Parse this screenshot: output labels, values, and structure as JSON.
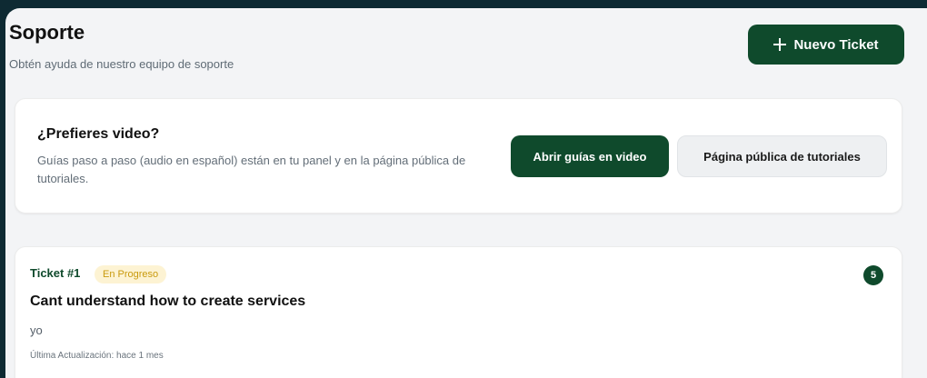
{
  "header": {
    "title": "Soporte",
    "subtitle": "Obtén ayuda de nuestro equipo de soporte",
    "new_ticket_label": "Nuevo Ticket"
  },
  "video_card": {
    "title": "¿Prefieres video?",
    "description": "Guías paso a paso (audio en español) están en tu panel y en la página pública de tutoriales.",
    "primary_button": "Abrir guías en video",
    "secondary_button": "Página pública de tutoriales"
  },
  "tickets": [
    {
      "number": "Ticket #1",
      "status": "En Progreso",
      "count": "5",
      "subject": "Cant understand how to create services",
      "author": "yo",
      "updated": "Última Actualización: hace 1 mes"
    }
  ],
  "colors": {
    "accent": "#0f4a2c",
    "background": "#0e2a33",
    "status_in_progress_bg": "#fdf3d3",
    "status_in_progress_text": "#c99a0e"
  },
  "icons": {
    "new_ticket": "plus-icon"
  }
}
